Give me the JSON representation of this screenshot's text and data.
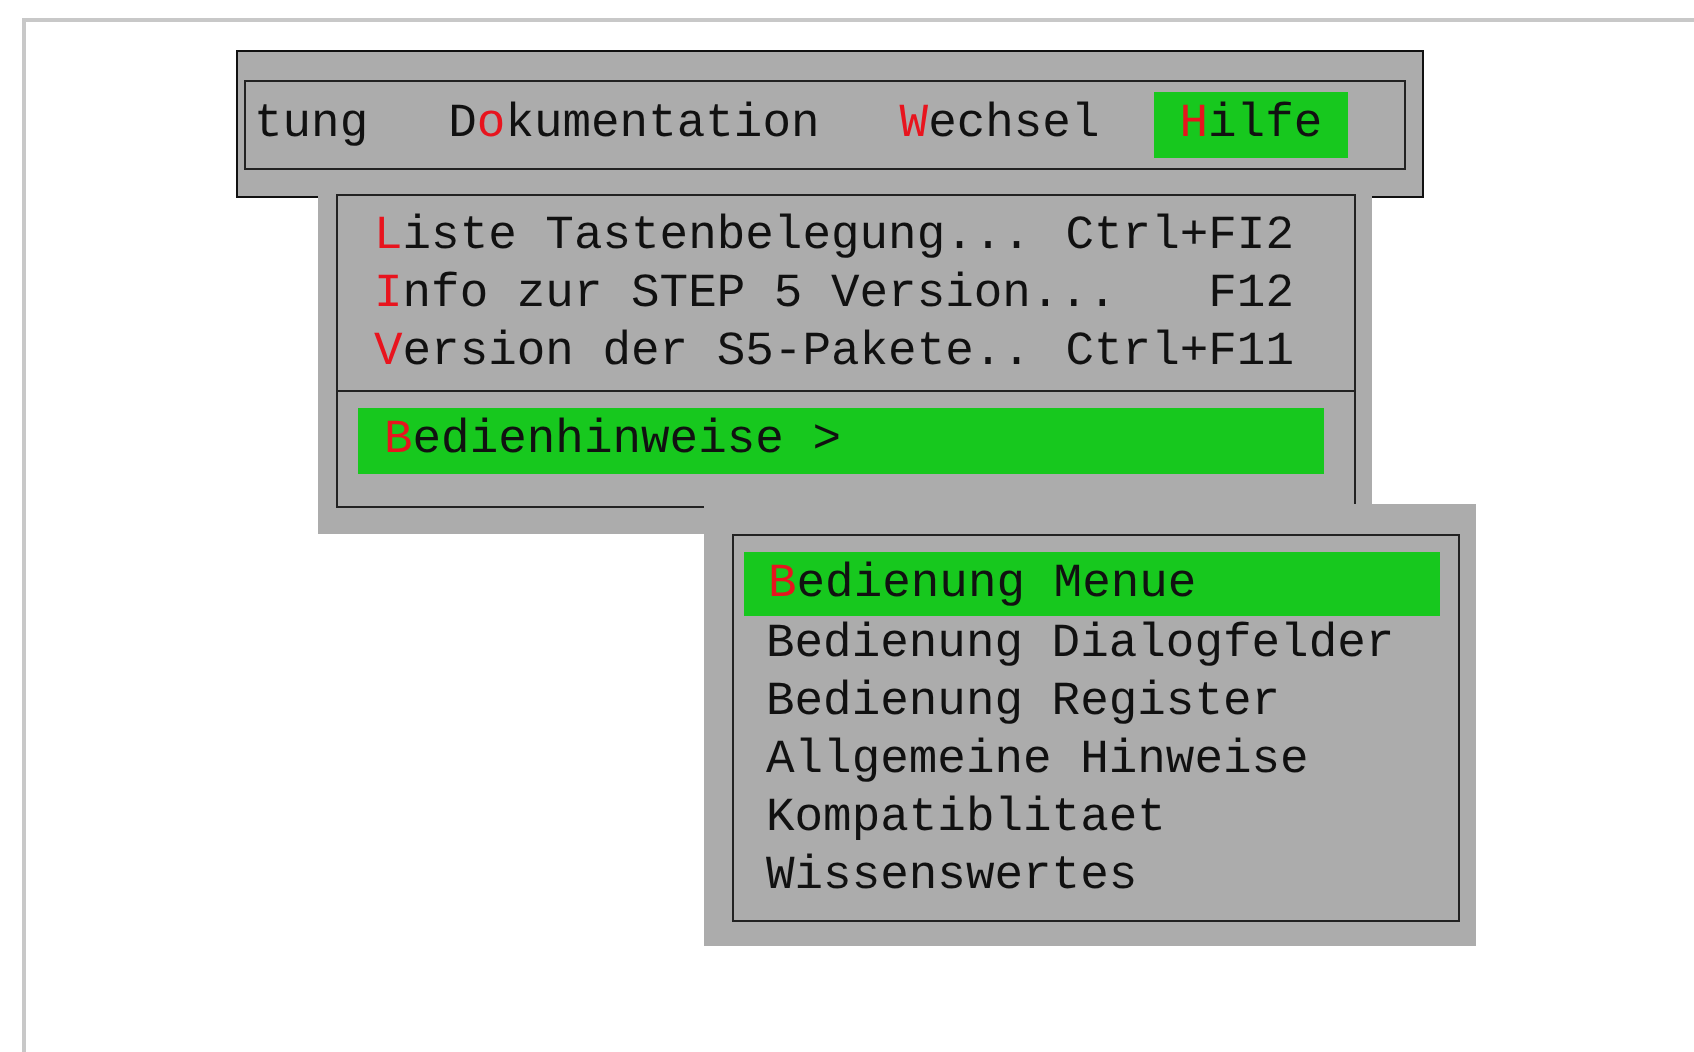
{
  "menu_bar": {
    "items": [
      {
        "before": "tung",
        "selected": false
      },
      {
        "before": "D",
        "hotkey": "o",
        "after": "kumentation",
        "selected": false
      },
      {
        "hotkey": "W",
        "after": "echsel",
        "selected": false
      },
      {
        "hotkey": "H",
        "after": "ilfe",
        "selected": true
      }
    ]
  },
  "dropdown": {
    "items": [
      {
        "hotkey": "L",
        "after": "iste Tastenbelegung...",
        "shortcut": "Ctrl+FI2",
        "selected": false
      },
      {
        "hotkey": "I",
        "after": "nfo zur STEP 5 Version...",
        "shortcut": "F12",
        "selected": false
      },
      {
        "hotkey": "V",
        "after": "ersion der S5-Pakete..",
        "shortcut": "Ctrl+F11",
        "selected": false
      }
    ],
    "submenu_item": {
      "hotkey": "B",
      "after": "edienhinweise >",
      "selected": true
    }
  },
  "submenu": {
    "items": [
      {
        "hotkey": "B",
        "after": "edienung Menue",
        "selected": true
      },
      {
        "before": "Bedienung Dialogfelder",
        "selected": false
      },
      {
        "before": "Bedienung Register",
        "selected": false
      },
      {
        "before": "Allgemeine Hinweise",
        "selected": false
      },
      {
        "before": "Kompatiblitaet",
        "selected": false
      },
      {
        "before": "Wissenswertes",
        "selected": false
      }
    ]
  }
}
